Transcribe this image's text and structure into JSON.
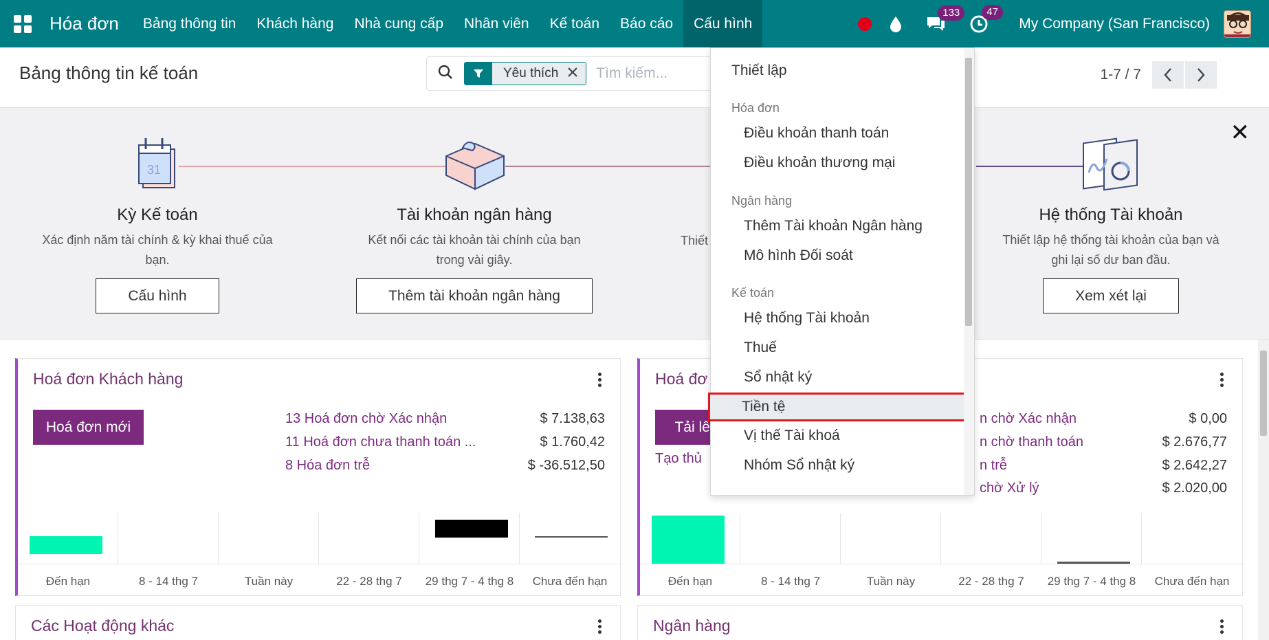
{
  "navbar": {
    "brand": "Hóa đơn",
    "menu": [
      {
        "label": "Bảng thông tin"
      },
      {
        "label": "Khách hàng"
      },
      {
        "label": "Nhà cung cấp"
      },
      {
        "label": "Nhân viên"
      },
      {
        "label": "Kế toán"
      },
      {
        "label": "Báo cáo"
      },
      {
        "label": "Cấu hình",
        "active": true
      }
    ],
    "messages_count": "133",
    "activities_count": "47",
    "company": "My Company (San Francisco)"
  },
  "control": {
    "title": "Bảng thông tin kế toán",
    "facet_label": "Yêu thích",
    "search_placeholder": "Tìm kiếm...",
    "pager": "1-7 / 7"
  },
  "onboarding": {
    "steps": [
      {
        "title": "Kỳ Kế toán",
        "desc_line1": "Xác định năm tài chính & kỳ khai thuế của",
        "desc_line2": "bạn.",
        "button": "Cấu hình",
        "calendar_day": "31"
      },
      {
        "title": "Tài khoản ngân hàng",
        "desc_line1": "Kết nối các tài khoản tài chính của bạn",
        "desc_line2": "trong vài giây.",
        "button": "Thêm tài khoản ngân hàng"
      },
      {
        "title": "",
        "desc_line1": "Thiết",
        "desc_line2": "",
        "button": ""
      },
      {
        "title": "Hệ thống Tài khoản",
        "desc_line1": "Thiết lập hệ thống tài khoản của bạn và",
        "desc_line2": "ghi lại số dư ban đầu.",
        "button": "Xem xét lại"
      }
    ]
  },
  "cards": {
    "customer_invoices": {
      "title": "Hoá đơn Khách hàng",
      "button": "Hoá đơn mới",
      "stats": [
        {
          "label": "13 Hoá đơn chờ Xác nhận",
          "amount": "$ 7.138,63"
        },
        {
          "label": "11 Hoá đơn chưa thanh toán ...",
          "amount": "$ 1.760,42"
        },
        {
          "label": "8 Hóa đơn trễ",
          "amount": "$ -36.512,50"
        }
      ],
      "graph_labels": [
        "Đến hạn",
        "8 - 14 thg 7",
        "Tuần này",
        "22 - 28 thg 7",
        "29 thg 7 - 4 thg 8",
        "Chưa đến hạn"
      ]
    },
    "vendor_bills": {
      "title": "Hoá đơ",
      "button": "Tải lên",
      "link": "Tạo thủ",
      "stats": [
        {
          "label": "n chờ Xác nhận",
          "amount": "$ 0,00"
        },
        {
          "label": "n chờ thanh toán",
          "amount": "$ 2.676,77"
        },
        {
          "label": "n trễ",
          "amount": "$ 2.642,27"
        },
        {
          "label": "chờ Xử lý",
          "amount": "$ 2.020,00"
        }
      ],
      "graph_labels": [
        "Đến hạn",
        "8 - 14 thg 7",
        "Tuần này",
        "22 - 28 thg 7",
        "29 thg 7 - 4 thg 8",
        "Chưa đến hạn"
      ]
    },
    "other": {
      "title": "Các Hoạt động khác"
    },
    "bank": {
      "title": "Ngân hàng"
    }
  },
  "dropdown": {
    "items": [
      {
        "type": "item",
        "label": "Thiết lập"
      },
      {
        "type": "header",
        "label": "Hóa đơn"
      },
      {
        "type": "sub",
        "label": "Điều khoản thanh toán"
      },
      {
        "type": "sub",
        "label": "Điều khoản thương mại"
      },
      {
        "type": "header",
        "label": "Ngân hàng"
      },
      {
        "type": "sub",
        "label": "Thêm Tài khoản Ngân hàng"
      },
      {
        "type": "sub",
        "label": "Mô hình Đối soát"
      },
      {
        "type": "header",
        "label": "Kế toán"
      },
      {
        "type": "sub",
        "label": "Hệ thống Tài khoản"
      },
      {
        "type": "sub",
        "label": "Thuế"
      },
      {
        "type": "sub",
        "label": "Sổ nhật ký"
      },
      {
        "type": "sub",
        "label": "Tiền tệ",
        "selected": true
      },
      {
        "type": "sub",
        "label": "Vị thế Tài khoá"
      },
      {
        "type": "sub",
        "label": "Nhóm Sổ nhật ký"
      }
    ]
  },
  "colors": {
    "navbar": "#017e84",
    "primary": "#7c2a7e",
    "accent_border": "#a349c9",
    "highlight": "#e0171f",
    "bar_green": "#00f5b2"
  }
}
